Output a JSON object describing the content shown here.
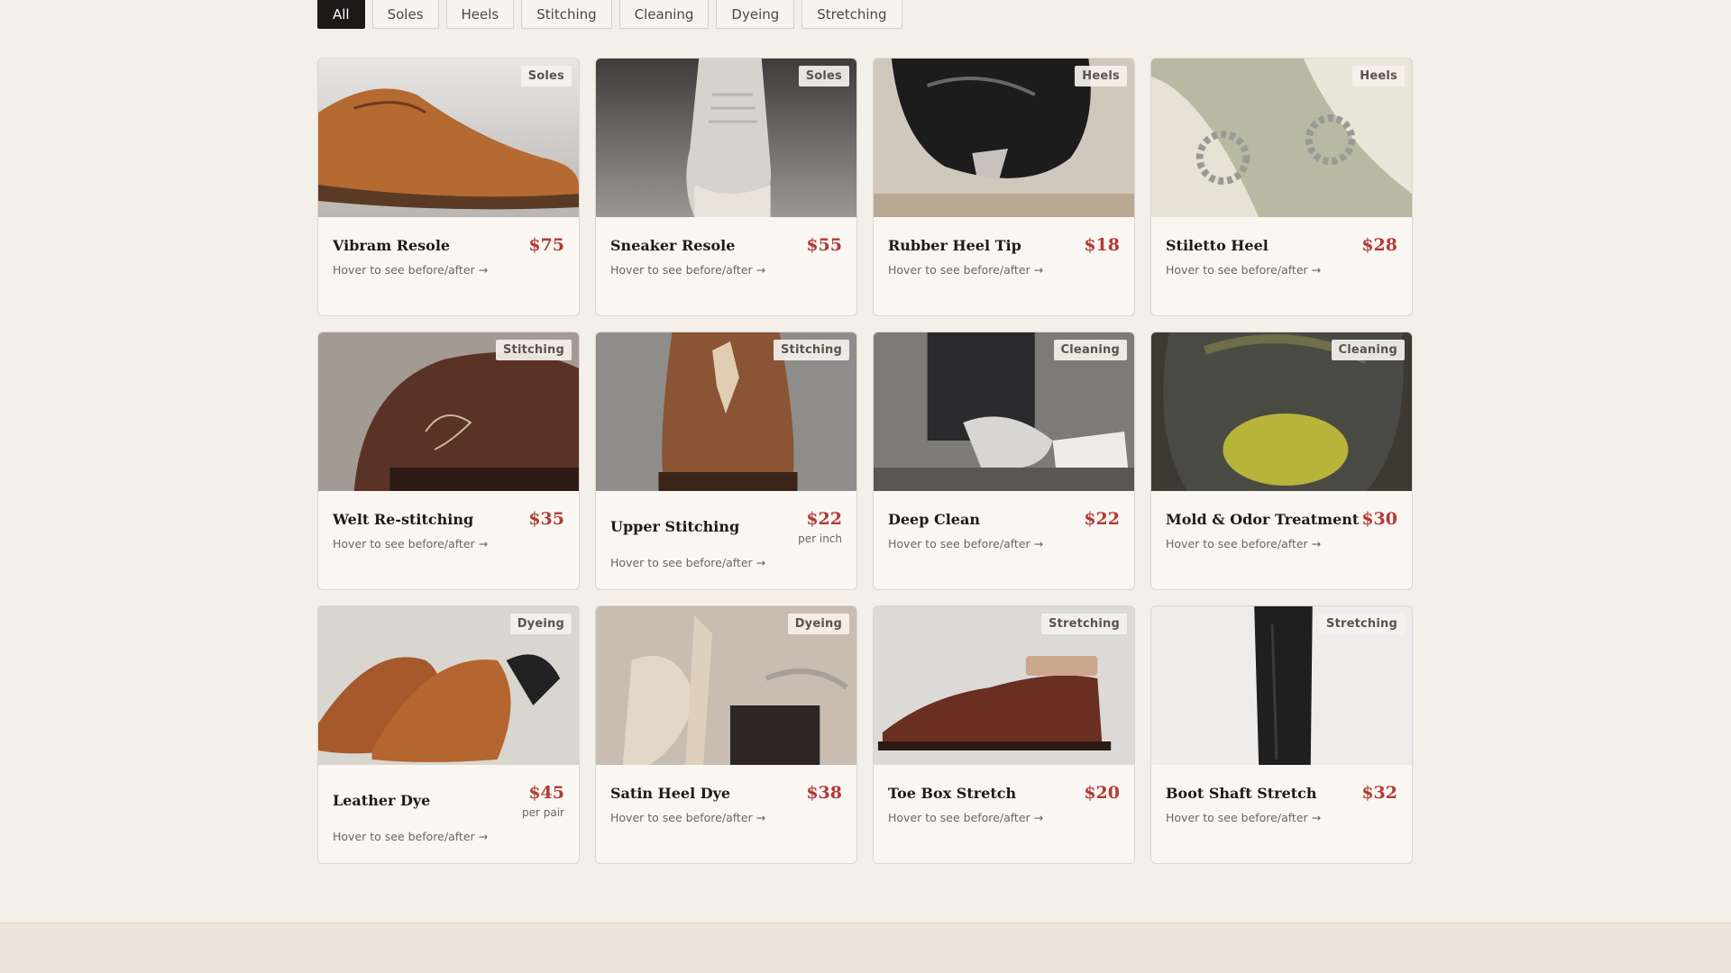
{
  "filters": [
    {
      "label": "All",
      "active": true
    },
    {
      "label": "Soles",
      "active": false
    },
    {
      "label": "Heels",
      "active": false
    },
    {
      "label": "Stitching",
      "active": false
    },
    {
      "label": "Cleaning",
      "active": false
    },
    {
      "label": "Dyeing",
      "active": false
    },
    {
      "label": "Stretching",
      "active": false
    }
  ],
  "services": [
    {
      "name": "Vibram Resole",
      "price": "$75",
      "unit": "",
      "category": "Soles",
      "hint": "Hover to see before/after →"
    },
    {
      "name": "Sneaker Resole",
      "price": "$55",
      "unit": "",
      "category": "Soles",
      "hint": "Hover to see before/after →"
    },
    {
      "name": "Rubber Heel Tip",
      "price": "$18",
      "unit": "",
      "category": "Heels",
      "hint": "Hover to see before/after →"
    },
    {
      "name": "Stiletto Heel",
      "price": "$28",
      "unit": "",
      "category": "Heels",
      "hint": "Hover to see before/after →"
    },
    {
      "name": "Welt Re-stitching",
      "price": "$35",
      "unit": "",
      "category": "Stitching",
      "hint": "Hover to see before/after →"
    },
    {
      "name": "Upper Stitching",
      "price": "$22",
      "unit": "per inch",
      "category": "Stitching",
      "hint": "Hover to see before/after →"
    },
    {
      "name": "Deep Clean",
      "price": "$22",
      "unit": "",
      "category": "Cleaning",
      "hint": "Hover to see before/after →"
    },
    {
      "name": "Mold & Odor Treatment",
      "price": "$30",
      "unit": "",
      "category": "Cleaning",
      "hint": "Hover to see before/after →"
    },
    {
      "name": "Leather Dye",
      "price": "$45",
      "unit": "per pair",
      "category": "Dyeing",
      "hint": "Hover to see before/after →"
    },
    {
      "name": "Satin Heel Dye",
      "price": "$38",
      "unit": "",
      "category": "Dyeing",
      "hint": "Hover to see before/after →"
    },
    {
      "name": "Toe Box Stretch",
      "price": "$20",
      "unit": "",
      "category": "Stretching",
      "hint": "Hover to see before/after →"
    },
    {
      "name": "Boot Shaft Stretch",
      "price": "$32",
      "unit": "",
      "category": "Stretching",
      "hint": "Hover to see before/after →"
    }
  ],
  "colors": {
    "background": "#f3efe9",
    "accent_price": "#b33a35",
    "active_filter": "#1c1a19"
  }
}
